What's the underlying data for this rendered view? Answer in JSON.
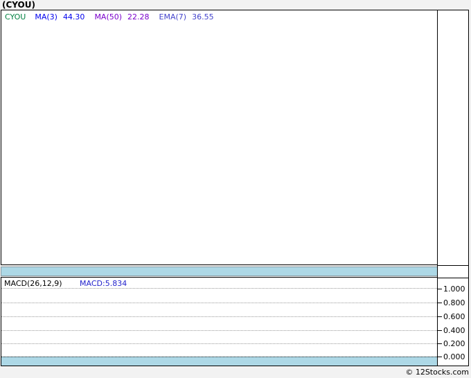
{
  "page": {
    "title": "(CYOU)",
    "footer_credit": "© 12Stocks.com"
  },
  "price_panel": {
    "legend": {
      "ticker": "CYOU",
      "indicators": [
        {
          "label": "MA(3)",
          "value": "44.30",
          "color": "#0000ee"
        },
        {
          "label": "MA(50)",
          "value": "22.28",
          "color": "#7a00cc"
        },
        {
          "label": "EMA(7)",
          "value": "36.55",
          "color": "#4343cc"
        }
      ]
    }
  },
  "macd_panel": {
    "indicator_label": "MACD(26,12,9)",
    "indicator_value": "MACD:5.834",
    "axis_ticks": [
      "1.000",
      "0.800",
      "0.600",
      "0.400",
      "0.200",
      "0.000"
    ]
  },
  "colors": {
    "page_background": "#f2f2f2",
    "panel_background": "#ffffff",
    "border": "#000000",
    "band_blue": "#add8e6",
    "ticker_green": "#008040",
    "ma3_blue": "#0000ee",
    "ma50_purple": "#7a00cc",
    "ema7_indigo": "#4343cc",
    "macd_value_blue": "#2222cc",
    "gridline_gray": "#999999"
  },
  "chart_data": [
    {
      "type": "line",
      "panel": "price",
      "title": "(CYOU)",
      "series": [
        {
          "name": "CYOU",
          "color": "#008040",
          "values": []
        },
        {
          "name": "MA(3)",
          "color": "#0000ee",
          "latest": 44.3,
          "values": []
        },
        {
          "name": "MA(50)",
          "color": "#7a00cc",
          "latest": 22.28,
          "values": []
        },
        {
          "name": "EMA(7)",
          "color": "#4343cc",
          "latest": 36.55,
          "values": []
        }
      ],
      "legend_position": "top-left",
      "grid": false,
      "note": "price panel is rendered empty in the screenshot"
    },
    {
      "type": "line",
      "panel": "macd",
      "title": "MACD(26,12,9)",
      "series": [
        {
          "name": "MACD",
          "latest": 5.834,
          "values": []
        }
      ],
      "ylim": [
        0.0,
        1.0
      ],
      "yticks": [
        1.0,
        0.8,
        0.6,
        0.4,
        0.2,
        0.0
      ],
      "legend_position": "top-left",
      "grid": true,
      "note": "MACD panel is rendered empty in the screenshot"
    }
  ]
}
